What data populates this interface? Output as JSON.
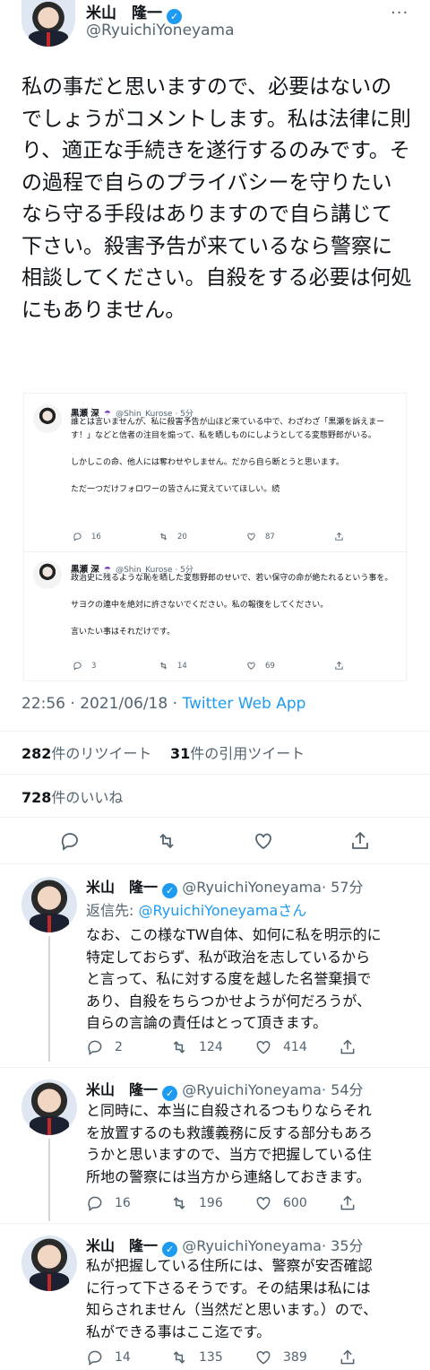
{
  "main_tweet": {
    "name": "米山　隆一",
    "handle": "@RyuichiYoneyama",
    "text": "私の事だと思いますので、必要はないのでしょうがコメントします。私は法律に則り、適正な手続きを遂行するのみです。その過程で自らのプライバシーを守りたいなら守る手段はありますので自ら講じて下さい。殺害予告が来ているなら警察に相談してください。自殺をする必要は何処にもありません。",
    "time": "22:56 · 2021/06/18 · ",
    "source": "Twitter Web App",
    "retweet_count": "282",
    "retweet_label": "件のリツイート",
    "quote_count": "31",
    "quote_label": "件の引用ツイート",
    "like_count": "728",
    "like_label": "件のいいね"
  },
  "embedded": {
    "tweet1": {
      "name": "黒瀬 深",
      "handle": "@Shin_Kurose · 5分",
      "text": "誰とは言いませんが、私に殺害予告が山ほど来ている中で、わざわざ「黒瀬を訴えまーす！」などと信者の注目を煽って、私を晒しものにしようとしてる変態野郎がいる。\n\nしかしこの命、他人には奪わせやしません。だから自ら断とうと思います。\n\nただ一つだけフォロワーの皆さんに覚えていてほしい。続",
      "reply": "16",
      "retweet": "20",
      "like": "87"
    },
    "tweet2": {
      "name": "黒瀬 深",
      "handle": "@Shin_Kurose · 5分",
      "text": "政治史に残るような恥を晒した変態野郎のせいで、若い保守の命が絶たれるという事を。\n\nサヨクの連中を絶対に許さないでください。私の報復をしてください。\n\n言いたい事はそれだけです。",
      "reply": "3",
      "retweet": "14",
      "like": "69"
    }
  },
  "replies": [
    {
      "name": "米山　隆一",
      "handle": "@RyuichiYoneyama",
      "age": "· 57分",
      "reply_to_label": "返信先: ",
      "reply_to_handle": "@RyuichiYoneyamaさん",
      "text": "なお、この様なTW自体、如何に私を明示的に特定しておらず、私が政治を志しているからと言って、私に対する度を越した名誉棄損であり、自殺をちらつかせようが何だろうが、自らの言論の責任はとって頂きます。",
      "reply": "2",
      "retweet": "124",
      "like": "414"
    },
    {
      "name": "米山　隆一",
      "handle": "@RyuichiYoneyama",
      "age": "· 54分",
      "text": "と同時に、本当に自殺されるつもりならそれを放置するのも救護義務に反する部分もあろうかと思いますので、当方で把握している住所地の警察には当方から連絡しておきます。",
      "reply": "16",
      "retweet": "196",
      "like": "600"
    },
    {
      "name": "米山　隆一",
      "handle": "@RyuichiYoneyama",
      "age": "· 35分",
      "text": "私が把握している住所には、警察が安否確認に行って下さるそうです。その結果は私には知らされません（当然だと思います。）ので、私ができる事はここ迄です。",
      "reply": "14",
      "retweet": "135",
      "like": "389"
    }
  ],
  "colors": {
    "accent": "#1d9bf0",
    "text": "#0f1419",
    "muted": "#536471",
    "divider": "#eff3f4"
  },
  "icons": [
    "verified-badge-icon",
    "more-icon",
    "reply-icon",
    "retweet-icon",
    "like-icon",
    "share-icon"
  ]
}
